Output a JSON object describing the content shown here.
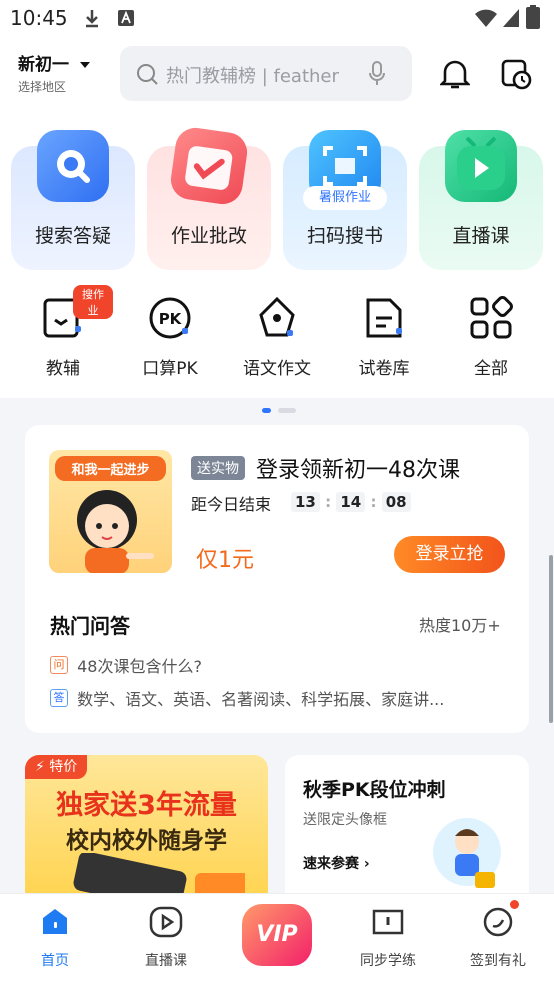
{
  "status": {
    "time": "10:45"
  },
  "header": {
    "grade": "新初一",
    "region": "选择地区",
    "search_placeholder": "热门教辅榜 | feather"
  },
  "features": [
    {
      "label": "搜索答疑"
    },
    {
      "label": "作业批改"
    },
    {
      "label": "扫码搜书",
      "tag": "暑假作业"
    },
    {
      "label": "直播课"
    }
  ],
  "tools": [
    {
      "label": "教辅",
      "badge": "搜作业"
    },
    {
      "label": "口算PK"
    },
    {
      "label": "语文作文"
    },
    {
      "label": "试卷库"
    },
    {
      "label": "全部"
    }
  ],
  "promo": {
    "image_text": "和我一起进步",
    "gift_tag": "送实物",
    "title": "登录领新初一48次课",
    "countdown_label": "距今日结束",
    "hh": "13",
    "mm": "14",
    "ss": "08",
    "price": "仅1元",
    "cta": "登录立抢"
  },
  "qa": {
    "title": "热门问答",
    "heat": "热度10万+",
    "q_badge": "问",
    "question": "48次课包含什么?",
    "a_badge": "答",
    "answer": "数学、语文、英语、名著阅读、科学拓展、家庭讲..."
  },
  "banner_left": {
    "tag": "特价",
    "line1": "独家送3年流量",
    "line2": "校内校外随身学"
  },
  "banner_right": {
    "title": "秋季PK段位冲刺",
    "subtitle": "送限定头像框",
    "link": "速来参赛"
  },
  "nav": [
    {
      "label": "首页"
    },
    {
      "label": "直播课"
    },
    {
      "label": "VIP"
    },
    {
      "label": "同步学练"
    },
    {
      "label": "签到有礼"
    }
  ],
  "colors": {
    "primary": "#2f74ff",
    "orange": "#f26a1b",
    "active": "#1e7bf2"
  }
}
